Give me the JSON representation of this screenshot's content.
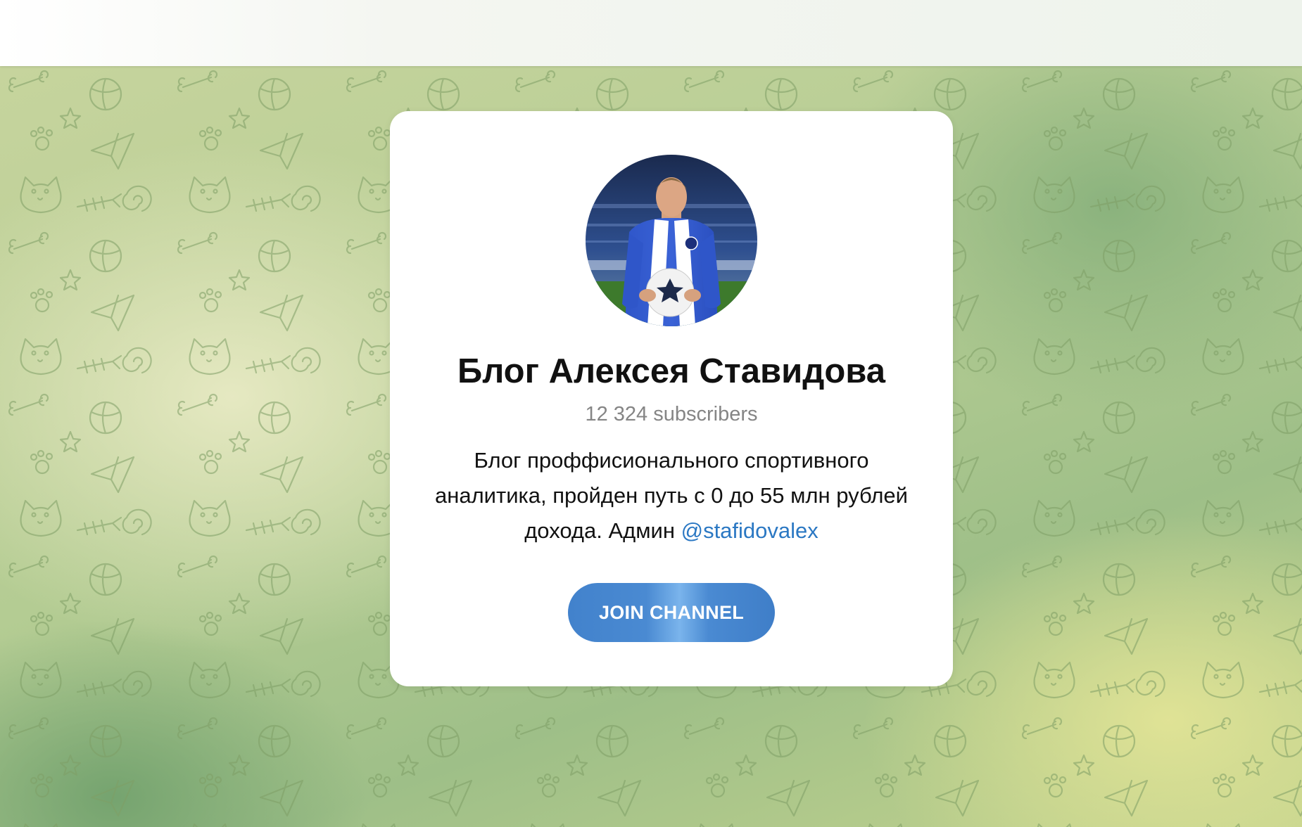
{
  "channel": {
    "title": "Блог Алексея Ставидова",
    "subscribers": "12 324 subscribers",
    "description_text": "Блог проффисионального спортивного аналитика, пройден путь с 0 до 55 млн рублей дохода. Админ ",
    "admin_mention": "@stafidovalex",
    "avatar": "footballer-photo"
  },
  "actions": {
    "join_label": "JOIN CHANNEL"
  },
  "colors": {
    "accent": "#4a8ad2",
    "mention": "#2b78c3",
    "subscribers_text": "#858585",
    "background": "#b4cc93"
  }
}
